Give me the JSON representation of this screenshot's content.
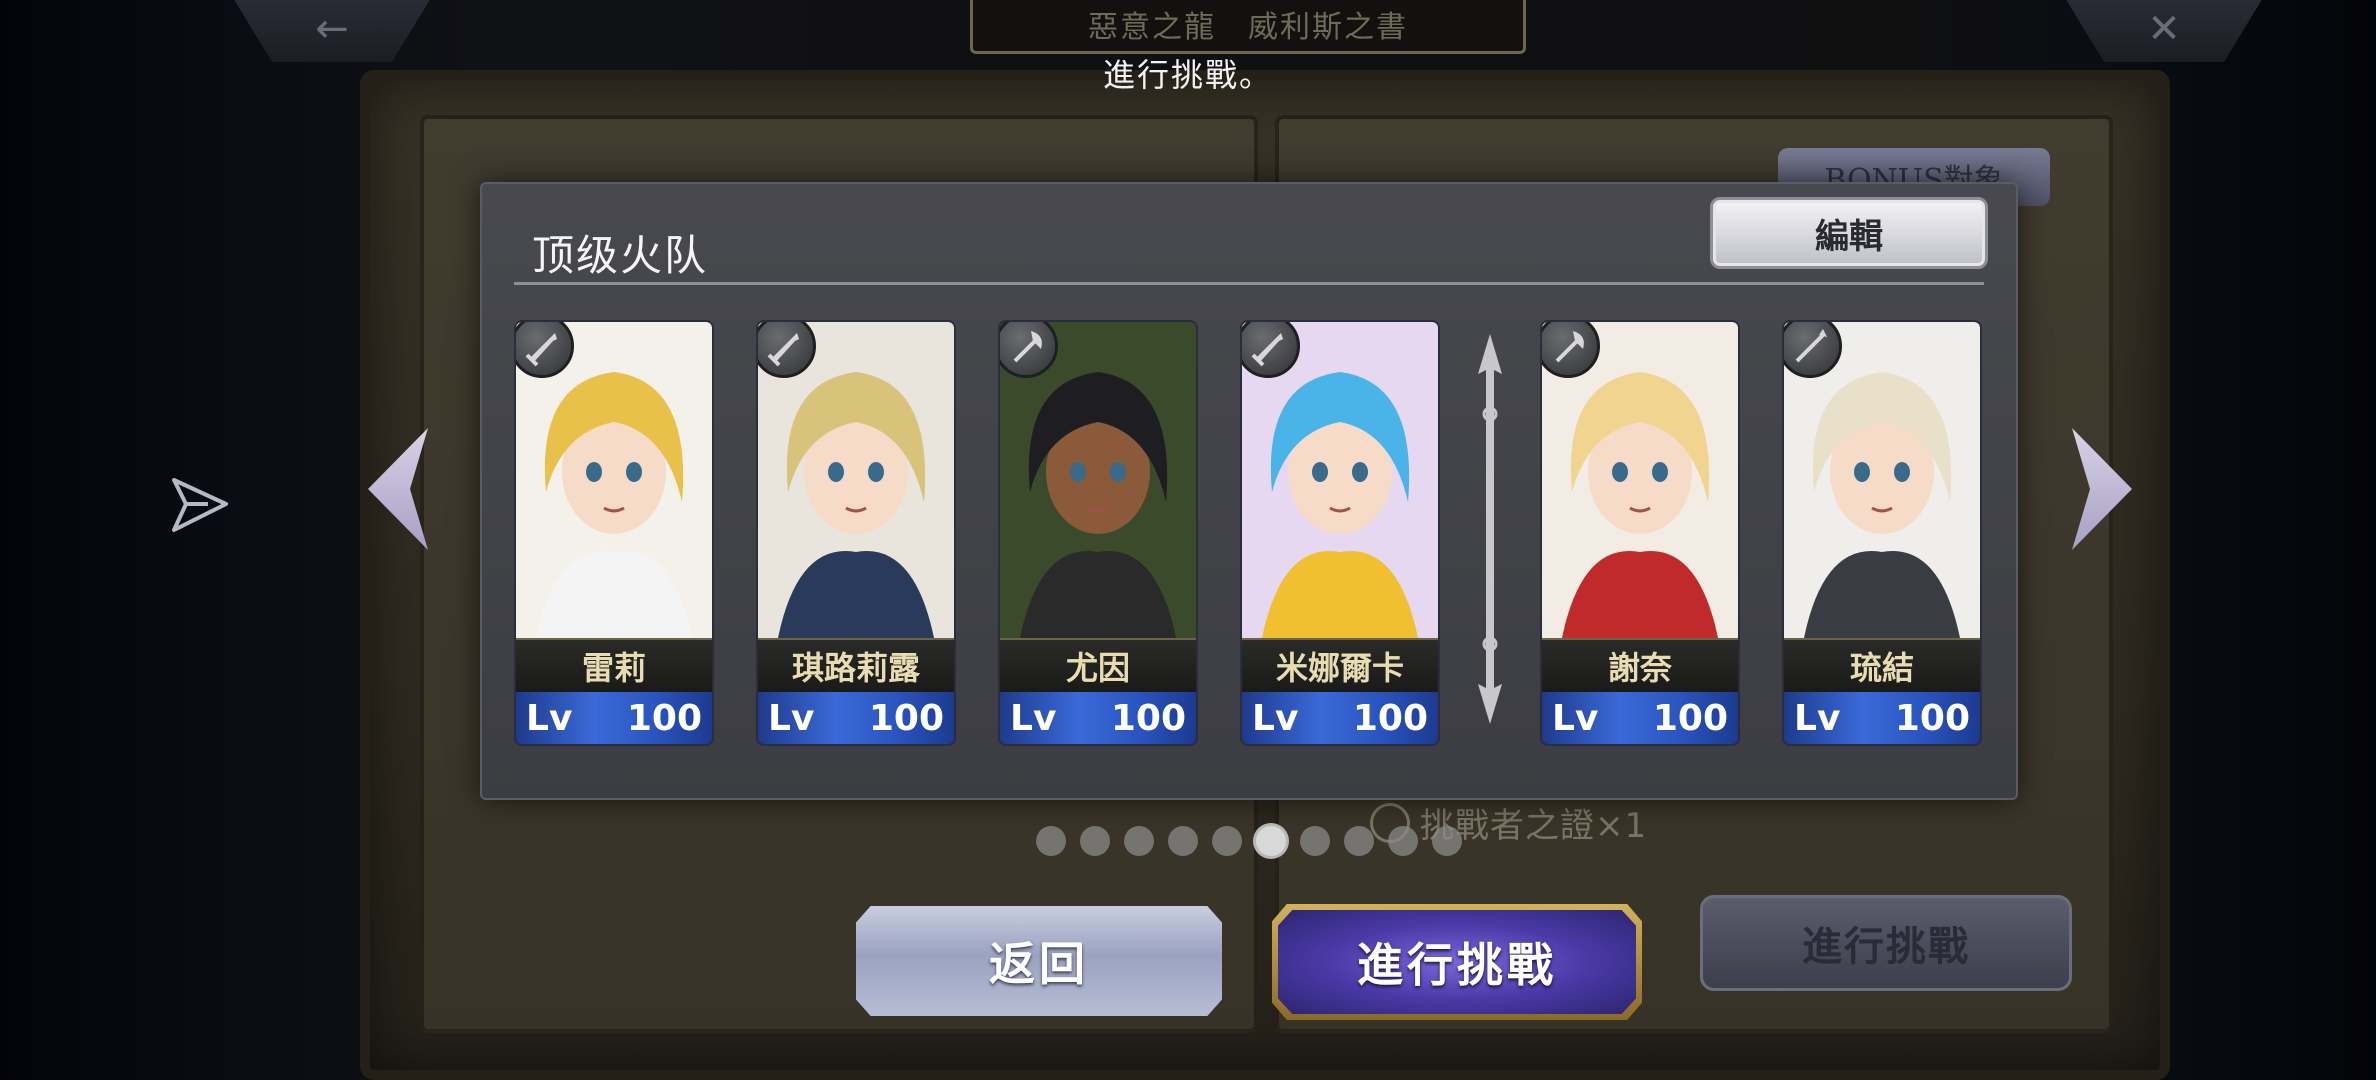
{
  "header": {
    "stage_title": "惡意之龍　威利斯之書",
    "subtitle": "進行挑戰。",
    "back_icon": "←",
    "close_icon": "✕"
  },
  "background": {
    "bonus_label": "BONUS對象",
    "certificate_text": "挑戰者之證×1",
    "challenge_label": "進行挑戰"
  },
  "party": {
    "name": "顶级火队",
    "edit_label": "編輯",
    "members": [
      {
        "name": "雷莉",
        "lv_label": "Lv",
        "level": "100",
        "weapon": "sword-icon",
        "hair": "#e8c04a",
        "bg": "#f4f1ea",
        "skin": "#f6dcc8",
        "outfit": "#f4f4f4"
      },
      {
        "name": "琪路莉露",
        "lv_label": "Lv",
        "level": "100",
        "weapon": "sword-icon",
        "hair": "#d9c27a",
        "bg": "#e9e4dc",
        "skin": "#f6dcc8",
        "outfit": "#2a3a5a"
      },
      {
        "name": "尤因",
        "lv_label": "Lv",
        "level": "100",
        "weapon": "axe-icon",
        "hair": "#1e1e22",
        "bg": "#3a4a2a",
        "skin": "#8a5a3a",
        "outfit": "#2a2a2a"
      },
      {
        "name": "米娜爾卡",
        "lv_label": "Lv",
        "level": "100",
        "weapon": "sword-icon",
        "hair": "#4ab4e8",
        "bg": "#e6d8f0",
        "skin": "#f6dcc8",
        "outfit": "#f0c030"
      },
      {
        "name": "謝奈",
        "lv_label": "Lv",
        "level": "100",
        "weapon": "axe-icon",
        "hair": "#f0d490",
        "bg": "#f2ece4",
        "skin": "#f6dcc8",
        "outfit": "#c02a2a"
      },
      {
        "name": "琉結",
        "lv_label": "Lv",
        "level": "100",
        "weapon": "spear-icon",
        "hair": "#e8e0c8",
        "bg": "#f0eeea",
        "skin": "#f6dcc8",
        "outfit": "#3a3c44"
      }
    ]
  },
  "pagination": {
    "total": 10,
    "current": 6
  },
  "actions": {
    "return_label": "返回",
    "challenge_label": "進行挑戰"
  }
}
